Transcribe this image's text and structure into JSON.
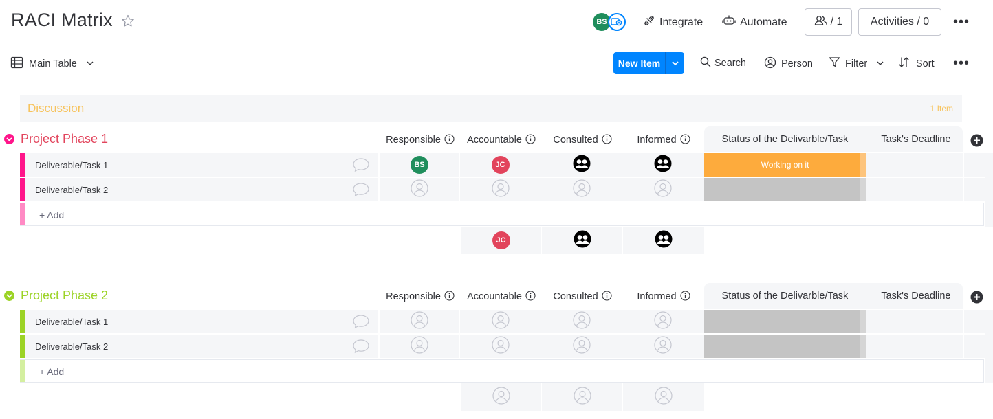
{
  "board": {
    "title": "RACI Matrix"
  },
  "header": {
    "avatar_initials": "BS",
    "integrate_label": "Integrate",
    "automate_label": "Automate",
    "members_count": "/ 1",
    "activities_label": "Activities / 0"
  },
  "toolbar": {
    "view_label": "Main Table",
    "new_item_label": "New Item",
    "search_label": "Search",
    "person_label": "Person",
    "filter_label": "Filter",
    "sort_label": "Sort"
  },
  "discussion": {
    "title": "Discussion",
    "count": "1 Item"
  },
  "columns": {
    "responsible": "Responsible",
    "accountable": "Accountable",
    "consulted": "Consulted",
    "informed": "Informed",
    "status": "Status of the Delivarble/Task",
    "deadline": "Task's Deadline"
  },
  "groups": [
    {
      "title": "Project Phase 1",
      "color": "#e2445c",
      "bar_color": "#ff158a",
      "add_bar_color": "#ff8ac4",
      "add_label": "+ Add",
      "rows": [
        {
          "name": "Deliverable/Task 1",
          "responsible": "BS",
          "accountable": "JC",
          "status": "Working on it",
          "status_color": "#fdab3d"
        },
        {
          "name": "Deliverable/Task 2",
          "status": "",
          "status_color": "#c4c4c4"
        }
      ],
      "summary_accountable": "JC"
    },
    {
      "title": "Project Phase 2",
      "color": "#9cd326",
      "bar_color": "#9cd326",
      "add_bar_color": "#d4efa0",
      "add_label": "+ Add",
      "rows": [
        {
          "name": "Deliverable/Task 1",
          "status": "",
          "status_color": "#c4c4c4"
        },
        {
          "name": "Deliverable/Task 2",
          "status": "",
          "status_color": "#c4c4c4"
        }
      ]
    }
  ],
  "colors": {
    "brand_blue": "#0085ff",
    "avatar_bs": "#1f8e5c",
    "avatar_jc": "#e2445c",
    "discussion": "#f7c35c"
  }
}
